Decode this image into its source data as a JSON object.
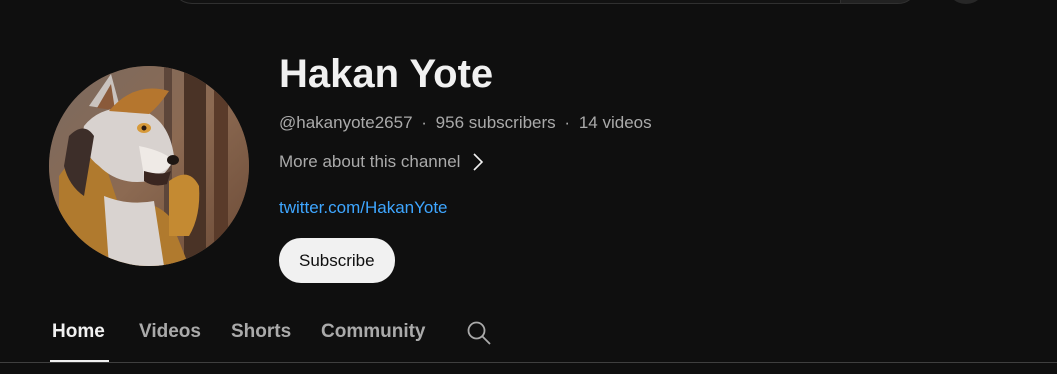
{
  "channel": {
    "name": "Hakan Yote",
    "handle": "@hakanyote2657",
    "separator": "·",
    "subscribers": "956 subscribers",
    "videos": "14 videos",
    "more_about": "More about this channel",
    "link": "twitter.com/HakanYote",
    "subscribe_label": "Subscribe"
  },
  "tabs": [
    {
      "label": "Home",
      "active": true
    },
    {
      "label": "Videos",
      "active": false
    },
    {
      "label": "Shorts",
      "active": false
    },
    {
      "label": "Community",
      "active": false
    }
  ],
  "icons": {
    "more_about": "chevron-right-icon",
    "tab_search": "search-icon"
  },
  "colors": {
    "background": "#0f0f0f",
    "text": "#f1f1f1",
    "secondary_text": "#aaaaaa",
    "link": "#3ea6ff",
    "subscribe_bg": "#f1f1f1"
  }
}
